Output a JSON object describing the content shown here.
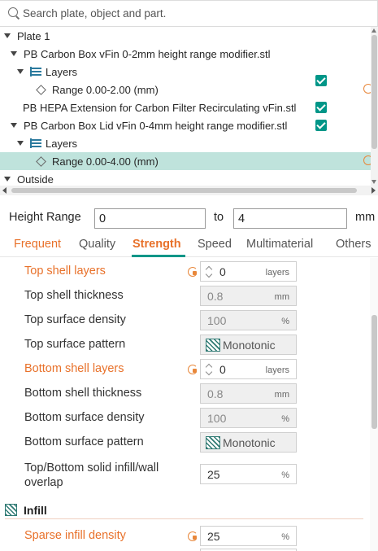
{
  "search": {
    "placeholder": "Search plate, object and part."
  },
  "tree": {
    "plate_label": "Plate 1",
    "objects": [
      {
        "name": "PB Carbon Box vFin 0-2mm height range modifier.stl",
        "layers_label": "Layers",
        "range": "Range 0.00-2.00 (mm)"
      },
      {
        "name": "PB HEPA Extension for Carbon Filter Recirculating vFin.stl"
      },
      {
        "name": "PB Carbon Box Lid vFin 0-4mm height range modifier.stl",
        "layers_label": "Layers",
        "range": "Range 0.00-4.00 (mm)"
      }
    ],
    "outside_label": "Outside"
  },
  "height_range": {
    "label": "Height Range",
    "from": "0",
    "to_label": "to",
    "to": "4",
    "unit": "mm"
  },
  "tabs": [
    "Frequent",
    "Quality",
    "Strength",
    "Speed",
    "Multimaterial",
    "Others"
  ],
  "active_tab": "Strength",
  "settings": [
    {
      "label": "Top shell layers",
      "value": "0",
      "unit": "layers",
      "modified": true
    },
    {
      "label": "Top shell thickness",
      "value": "0.8",
      "unit": "mm"
    },
    {
      "label": "Top surface density",
      "value": "100",
      "unit": "%"
    },
    {
      "label": "Top surface pattern",
      "value": "Monotonic"
    },
    {
      "label": "Bottom shell layers",
      "value": "0",
      "unit": "layers",
      "modified": true
    },
    {
      "label": "Bottom shell thickness",
      "value": "0.8",
      "unit": "mm"
    },
    {
      "label": "Bottom surface density",
      "value": "100",
      "unit": "%"
    },
    {
      "label": "Bottom surface pattern",
      "value": "Monotonic"
    },
    {
      "label": "Top/Bottom solid infill/wall overlap",
      "label_line1": "Top/Bottom solid infill/wall",
      "label_line2": "overlap",
      "value": "25",
      "unit": "%"
    }
  ],
  "infill": {
    "section_label": "Infill",
    "sparse_density": {
      "label": "Sparse infill density",
      "value": "25",
      "unit": "%",
      "modified": true
    }
  },
  "colors": {
    "accent": "#009688",
    "modified": "#e8712a",
    "selected_row": "#bfe3dc"
  }
}
